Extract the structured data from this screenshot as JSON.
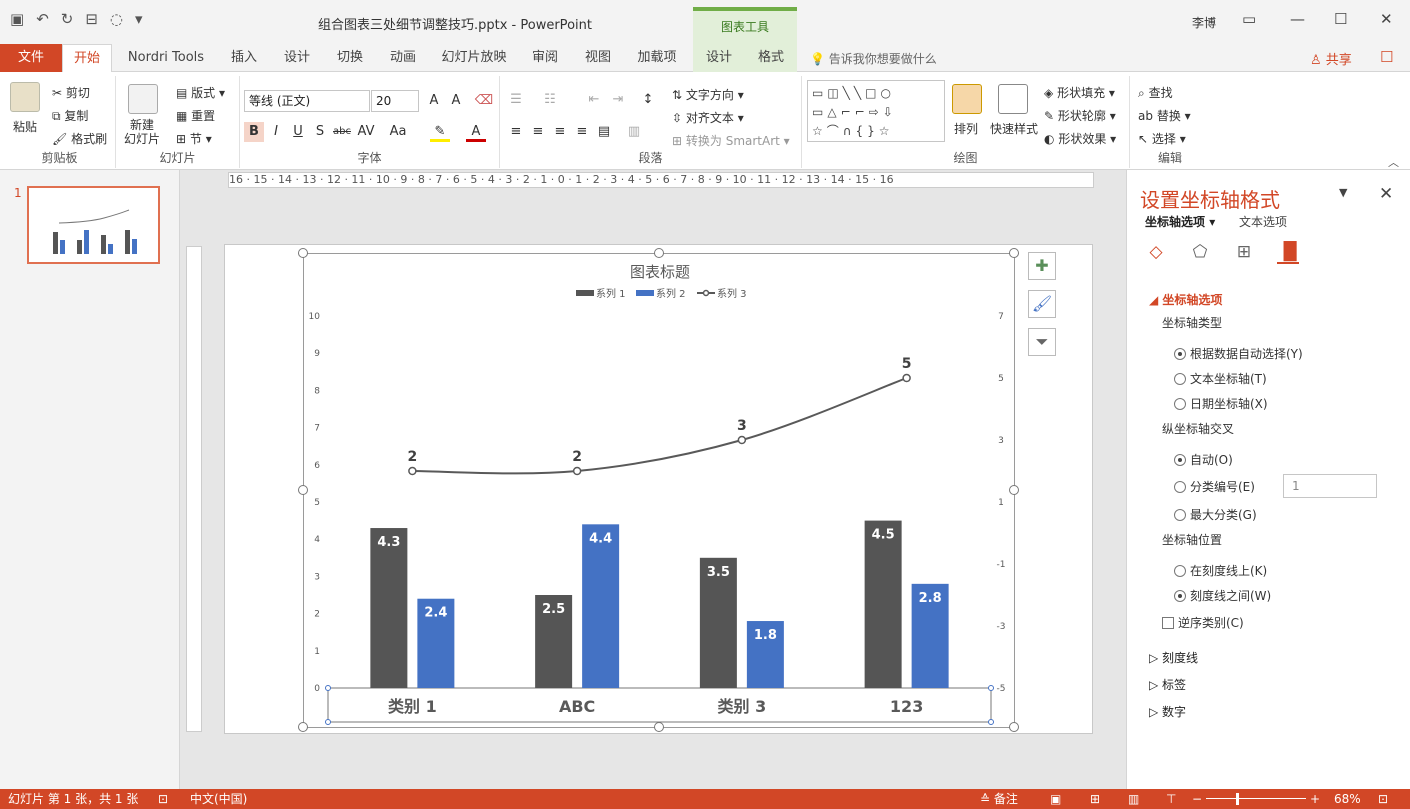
{
  "title_bar": {
    "document_title": "组合图表三处细节调整技巧.pptx  -  PowerPoint",
    "context_tab_header": "图表工具",
    "user_name": "李博"
  },
  "tabs": [
    "文件",
    "开始",
    "Nordri Tools",
    "插入",
    "设计",
    "切换",
    "动画",
    "幻灯片放映",
    "审阅",
    "视图",
    "加载项",
    "设计",
    "格式"
  ],
  "tell_me": "告诉我你想要做什么",
  "share": "共享",
  "ribbon": {
    "clipboard": {
      "paste": "粘贴",
      "cut": "剪切",
      "copy": "复制",
      "format_painter": "格式刷",
      "label": "剪贴板"
    },
    "slides": {
      "new_slide": "新建\n幻灯片",
      "layout": "版式",
      "reset": "重置",
      "section": "节",
      "label": "幻灯片"
    },
    "font": {
      "font_name": "等线 (正文)",
      "font_size": "20",
      "label": "字体"
    },
    "paragraph": {
      "text_direction": "文字方向",
      "align_text": "对齐文本",
      "convert_smartart": "转换为 SmartArt",
      "label": "段落"
    },
    "drawing": {
      "arrange": "排列",
      "quick_styles": "快速样式",
      "shape_fill": "形状填充",
      "shape_outline": "形状轮廓",
      "shape_effects": "形状效果",
      "label": "绘图"
    },
    "editing": {
      "find": "查找",
      "replace": "替换",
      "select": "选择",
      "label": "编辑"
    }
  },
  "thumbnail": {
    "slide_number": "1"
  },
  "ruler": {
    "horizontal": "16 · 15 · 14 · 13 · 12 · 11 · 10 · 9 · 8 · 7 · 6 · 5 · 4 · 3 · 2 · 1 · 0 · 1 · 2 · 3 · 4 · 5 · 6 · 7 · 8 · 9 · 10 · 11 · 12 · 13 · 14 · 15 · 16"
  },
  "chart_data": {
    "type": "bar",
    "title": "图表标题",
    "categories": [
      "类别 1",
      "ABC",
      "类别 3",
      "123"
    ],
    "series": [
      {
        "name": "系列 1",
        "type": "bar",
        "values": [
          4.3,
          2.5,
          3.5,
          4.5
        ],
        "color": "#555555",
        "axis": "left"
      },
      {
        "name": "系列 2",
        "type": "bar",
        "values": [
          2.4,
          4.4,
          1.8,
          2.8
        ],
        "color": "#4472c4",
        "axis": "left"
      },
      {
        "name": "系列 3",
        "type": "line",
        "values": [
          2,
          2,
          3,
          5
        ],
        "color": "#595959",
        "axis": "right"
      }
    ],
    "left_axis": {
      "min": 0,
      "max": 10,
      "ticks": [
        "0",
        "1",
        "2",
        "3",
        "4",
        "5",
        "6",
        "7",
        "8",
        "9",
        "10"
      ]
    },
    "right_axis": {
      "min": -5,
      "max": 7,
      "ticks": [
        "-5",
        "-3",
        "-1",
        "1",
        "3",
        "5",
        "7"
      ]
    },
    "legend_position": "top",
    "grid": false
  },
  "format_pane": {
    "title": "设置坐标轴格式",
    "tab_axis_options": "坐标轴选项",
    "tab_text_options": "文本选项",
    "section_axis_options": "坐标轴选项",
    "axis_type_label": "坐标轴类型",
    "axis_type_options": [
      "根据数据自动选择(Y)",
      "文本坐标轴(T)",
      "日期坐标轴(X)"
    ],
    "crosses_label": "纵坐标轴交叉",
    "crosses_options": [
      "自动(O)",
      "分类编号(E)",
      "最大分类(G)"
    ],
    "category_number_value": "1",
    "position_label": "坐标轴位置",
    "position_options": [
      "在刻度线上(K)",
      "刻度线之间(W)"
    ],
    "reverse_order": "逆序类别(C)",
    "collapsed_sections": [
      "刻度线",
      "标签",
      "数字"
    ]
  },
  "status_bar": {
    "slide_info": "幻灯片 第 1 张，共 1 张",
    "language": "中文(中国)",
    "notes": "备注",
    "zoom": "68%"
  }
}
